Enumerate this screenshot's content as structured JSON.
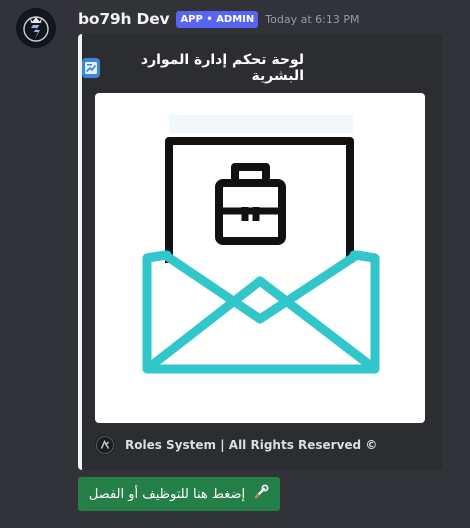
{
  "message": {
    "author": "bo79h Dev",
    "badge": "APP • ADMIN",
    "timestamp": "Today at 6:13 PM",
    "avatar_icon": "crowned-shield-logo-icon"
  },
  "embed": {
    "accent_color": "#f2f3f5",
    "title": "لوحة تحكم إدارة الموارد البشرية",
    "title_icon": "staff-list-icon",
    "image_icon": "open-envelope-with-briefcase-document-icon",
    "footer": {
      "text": "Roles System | All Rights Reserved ©",
      "icon": "roles-system-logo-icon"
    }
  },
  "button": {
    "label": "إضغط هنا للتوظيف أو الفصل",
    "icon": "wrench-icon",
    "color": "#248046"
  }
}
